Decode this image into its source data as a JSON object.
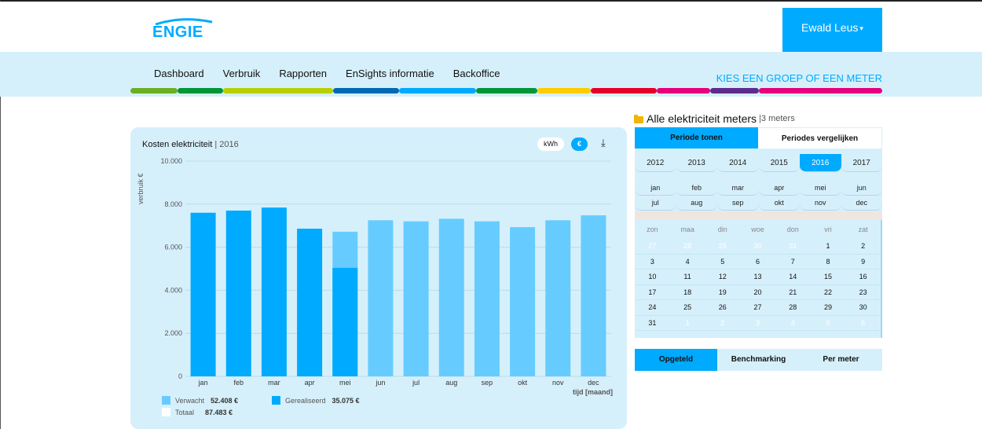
{
  "header": {
    "logo_text": "ENGIE",
    "user_name": "Ewald Leus",
    "user_caret": "▾"
  },
  "nav": {
    "items": [
      "Dashboard",
      "Verbruik",
      "Rapporten",
      "EnSights informatie",
      "Backoffice"
    ],
    "right_link": "KIES EEN GROEP OF EEN METER"
  },
  "colorbar": [
    "#6ab023",
    "#009639",
    "#b9cf00",
    "#0069b4",
    "#00aaff",
    "#009639",
    "#ffcc00",
    "#e4002b",
    "#e5007d",
    "#5f2b8b",
    "#e5007d"
  ],
  "chart_panel": {
    "title": "Kosten elektriciteit",
    "title_sep": " | ",
    "year": "2016",
    "toggle_kwh": "kWh",
    "toggle_eur": "€",
    "download_icon": "download-icon",
    "ylabel": "verbruik €",
    "xlabel": "tijd [maand]"
  },
  "chart_data": {
    "type": "bar",
    "categories": [
      "jan",
      "feb",
      "mar",
      "apr",
      "mei",
      "jun",
      "jul",
      "aug",
      "sep",
      "okt",
      "nov",
      "dec"
    ],
    "series": [
      {
        "name": "Verwacht",
        "values": [
          null,
          null,
          null,
          null,
          6720,
          7250,
          7200,
          7320,
          7200,
          6930,
          7250,
          7480
        ],
        "color": "#66ccff"
      },
      {
        "name": "Gerealiseerd",
        "values": [
          7600,
          7700,
          7840,
          6860,
          5040,
          null,
          null,
          null,
          null,
          null,
          null,
          null
        ],
        "color": "#00aaff"
      }
    ],
    "yticks": [
      "0",
      "2.000",
      "4.000",
      "6.000",
      "8.000",
      "10.000"
    ],
    "ylim": [
      0,
      10000
    ],
    "grid": true
  },
  "legend": [
    {
      "label": "Verwacht",
      "value": "52.408 €",
      "color": "#66ccff"
    },
    {
      "label": "Gerealiseerd",
      "value": "35.075 €",
      "color": "#00aaff"
    },
    {
      "label": "Totaal",
      "value": "87.483 €",
      "color": "#ffffff"
    }
  ],
  "meters": {
    "title": "Alle elektriciteit meters",
    "sep": " | ",
    "count": "3 meters"
  },
  "period_tabs": [
    "Periode tonen",
    "Periodes vergelijken"
  ],
  "years": [
    "2012",
    "2013",
    "2014",
    "2015",
    "2016",
    "2017"
  ],
  "active_year": "2016",
  "months": [
    [
      "jan",
      "feb",
      "mar",
      "apr",
      "mei",
      "jun"
    ],
    [
      "jul",
      "aug",
      "sep",
      "okt",
      "nov",
      "dec"
    ]
  ],
  "weekdays": [
    "zon",
    "maa",
    "din",
    "woe",
    "don",
    "vri",
    "zat"
  ],
  "calendar": [
    [
      {
        "d": "27",
        "dim": true
      },
      {
        "d": "28",
        "dim": true
      },
      {
        "d": "29",
        "dim": true
      },
      {
        "d": "30",
        "dim": true
      },
      {
        "d": "31",
        "dim": true
      },
      {
        "d": "1"
      },
      {
        "d": "2"
      }
    ],
    [
      {
        "d": "3"
      },
      {
        "d": "4"
      },
      {
        "d": "5"
      },
      {
        "d": "6"
      },
      {
        "d": "7"
      },
      {
        "d": "8"
      },
      {
        "d": "9"
      }
    ],
    [
      {
        "d": "10"
      },
      {
        "d": "11"
      },
      {
        "d": "12"
      },
      {
        "d": "13"
      },
      {
        "d": "14"
      },
      {
        "d": "15"
      },
      {
        "d": "16"
      }
    ],
    [
      {
        "d": "17"
      },
      {
        "d": "18"
      },
      {
        "d": "19"
      },
      {
        "d": "20"
      },
      {
        "d": "21"
      },
      {
        "d": "22"
      },
      {
        "d": "23"
      }
    ],
    [
      {
        "d": "24"
      },
      {
        "d": "25"
      },
      {
        "d": "26"
      },
      {
        "d": "27"
      },
      {
        "d": "28"
      },
      {
        "d": "29"
      },
      {
        "d": "30"
      }
    ],
    [
      {
        "d": "31"
      },
      {
        "d": "1",
        "dim": true
      },
      {
        "d": "2",
        "dim": true
      },
      {
        "d": "3",
        "dim": true
      },
      {
        "d": "4",
        "dim": true
      },
      {
        "d": "5",
        "dim": true
      },
      {
        "d": "6",
        "dim": true
      }
    ]
  ],
  "bottom_tabs": [
    "Opgeteld",
    "Benchmarking",
    "Per meter"
  ]
}
